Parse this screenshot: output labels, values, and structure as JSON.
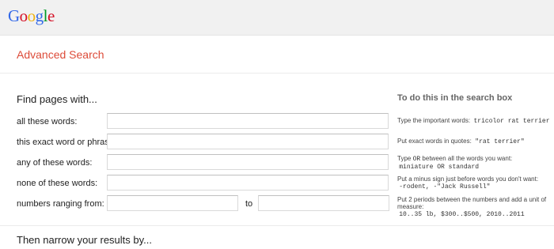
{
  "header": {
    "logo_letters": [
      "G",
      "o",
      "o",
      "g",
      "l",
      "e"
    ],
    "logo_colors": [
      "#3369e8",
      "#d50f25",
      "#eeb211",
      "#3369e8",
      "#009925",
      "#d50f25"
    ]
  },
  "page_title": "Advanced Search",
  "accent_color": "#dd4b39",
  "find_section": {
    "heading": "Find pages with...",
    "help_heading": "To do this in the search box",
    "rows": [
      {
        "label": "all these words:",
        "value": "",
        "help_text": "Type the important words:",
        "help_code": "tricolor rat terrier"
      },
      {
        "label": "this exact word or phrase:",
        "value": "",
        "help_text": "Put exact words in quotes:",
        "help_code": "\"rat terrier\""
      },
      {
        "label": "any of these words:",
        "value": "",
        "help_pre": "Type",
        "help_op": "OR",
        "help_text": "between all the words you want:",
        "help_code": "miniature OR standard"
      },
      {
        "label": "none of these words:",
        "value": "",
        "help_text": "Put a minus sign just before words you don't want:",
        "help_code": "-rodent, -\"Jack Russell\""
      },
      {
        "label": "numbers ranging from:",
        "from_value": "",
        "to_label": "to",
        "to_value": "",
        "help_text": "Put 2 periods between the numbers and add a unit of measure:",
        "help_code": "10..35 lb, $300..$500, 2010..2011"
      }
    ]
  },
  "narrow_section": {
    "heading": "Then narrow your results by..."
  }
}
